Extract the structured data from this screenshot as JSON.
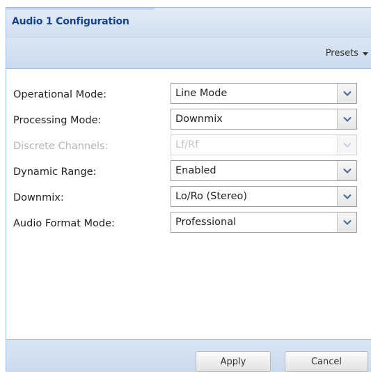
{
  "panel": {
    "title": "Audio 1 Configuration"
  },
  "toolbar": {
    "presets_label": "Presets"
  },
  "form": {
    "fields": [
      {
        "label": "Operational Mode:",
        "value": "Line Mode",
        "disabled": false
      },
      {
        "label": "Processing Mode:",
        "value": "Downmix",
        "disabled": false
      },
      {
        "label": "Discrete Channels:",
        "value": "Lf/Rf",
        "disabled": true
      },
      {
        "label": "Dynamic Range:",
        "value": "Enabled",
        "disabled": false
      },
      {
        "label": "Downmix:",
        "value": "Lo/Ro (Stereo)",
        "disabled": false
      },
      {
        "label": "Audio Format Mode:",
        "value": "Professional",
        "disabled": false
      }
    ]
  },
  "footer": {
    "apply_label": "Apply",
    "cancel_label": "Cancel"
  },
  "icons": {
    "combo_trigger": "chevron-down-icon",
    "presets_caret": "caret-down-icon"
  },
  "colors": {
    "header_title": "#15428b",
    "panel_border": "#99bbe8",
    "chevron": "#4a6ea0"
  }
}
